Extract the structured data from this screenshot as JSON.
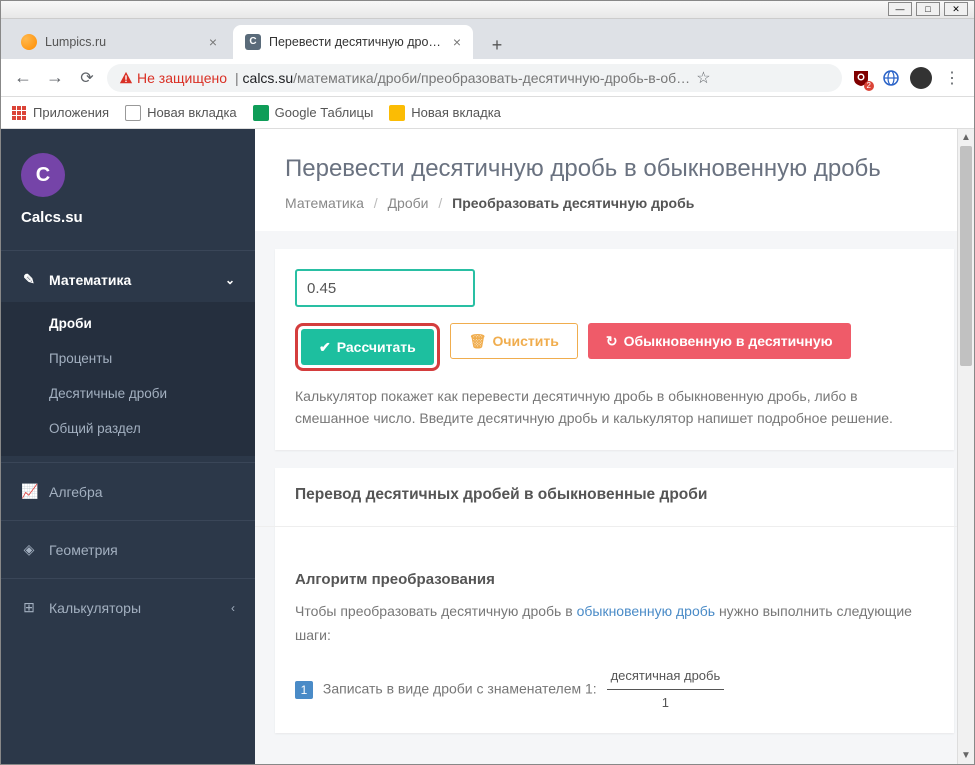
{
  "window": {
    "tabs": [
      {
        "title": "Lumpics.ru",
        "active": false
      },
      {
        "title": "Перевести десятичную дробь в",
        "active": true,
        "favicon_letter": "C"
      }
    ],
    "toolbar": {
      "not_secure": "Не защищено",
      "url_domain": "calcs.su",
      "url_path": "/математика/дроби/преобразовать-десятичную-дробь-в-об…",
      "ublock_badge": "2"
    },
    "bookmarks": [
      {
        "label": "Приложения",
        "icon": "apps"
      },
      {
        "label": "Новая вкладка",
        "icon": "file"
      },
      {
        "label": "Google Таблицы",
        "icon": "sheets"
      },
      {
        "label": "Новая вкладка",
        "icon": "yellow"
      }
    ]
  },
  "sidebar": {
    "brand_letter": "C",
    "brand_name": "Calcs.su",
    "items": [
      {
        "icon": "✎",
        "label": "Математика",
        "expanded": true,
        "active": true,
        "sub": [
          {
            "label": "Дроби",
            "active": true
          },
          {
            "label": "Проценты"
          },
          {
            "label": "Десятичные дроби"
          },
          {
            "label": "Общий раздел"
          }
        ]
      },
      {
        "icon": "📈",
        "label": "Алгебра"
      },
      {
        "icon": "◈",
        "label": "Геометрия"
      },
      {
        "icon": "⊞",
        "label": "Калькуляторы",
        "collapsed_left": true
      }
    ]
  },
  "main": {
    "title": "Перевести десятичную дробь в обыкновенную дробь",
    "breadcrumb": [
      "Математика",
      "Дроби",
      "Преобразовать десятичную дробь"
    ],
    "input_value": "0.45",
    "buttons": {
      "calc": "Рассчитать",
      "clear": "Очистить",
      "swap": "Обыкновенную в десятичную"
    },
    "description": "Калькулятор покажет как перевести десятичную дробь в обыкновенную дробь, либо в смешанное число. Введите десятичную дробь и калькулятор напишет подробное решение.",
    "section_title": "Перевод десятичных дробей в обыкновенные дроби",
    "algo_title": "Алгоритм преобразования",
    "algo_intro_1": "Чтобы преобразовать десятичную дробь в ",
    "algo_intro_link": "обыкновенную дробь",
    "algo_intro_2": " нужно выполнить следующие шаги:",
    "step1_num": "1",
    "step1_text": "Записать в виде дроби с знаменателем 1: ",
    "formula_top": "десятичная дробь",
    "formula_bot": "1"
  }
}
